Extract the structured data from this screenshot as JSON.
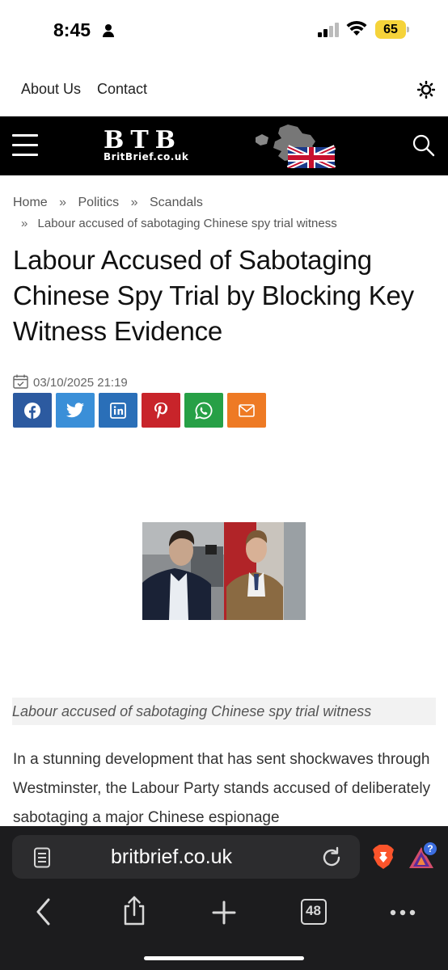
{
  "status": {
    "time": "8:45",
    "battery": "65"
  },
  "topnav": {
    "about": "About Us",
    "contact": "Contact"
  },
  "logo": {
    "main": "BTB",
    "sub": "BritBrief.co.uk"
  },
  "breadcrumb": {
    "home": "Home",
    "sep": "»",
    "politics": "Politics",
    "scandals": "Scandals",
    "current": "Labour accused of sabotaging Chinese spy trial witness"
  },
  "article": {
    "title": "Labour Accused of Sabotaging Chinese Spy Trial by Blocking Key Witness Evidence",
    "date": "03/10/2025 21:19",
    "caption": "Labour accused of sabotaging Chinese spy trial witness",
    "intro": "In a stunning development that has sent shockwaves through Westminster, the Labour Party stands accused of deliberately sabotaging a major Chinese espionage"
  },
  "share_colors": {
    "facebook": "#2c5aa0",
    "twitter": "#3a8fd8",
    "linkedin": "#2a6fb8",
    "pinterest": "#c8242a",
    "whatsapp": "#27a046",
    "email": "#ee7a24"
  },
  "browser": {
    "url": "britbrief.co.uk",
    "tabs": "48",
    "brave_badge": "?"
  }
}
